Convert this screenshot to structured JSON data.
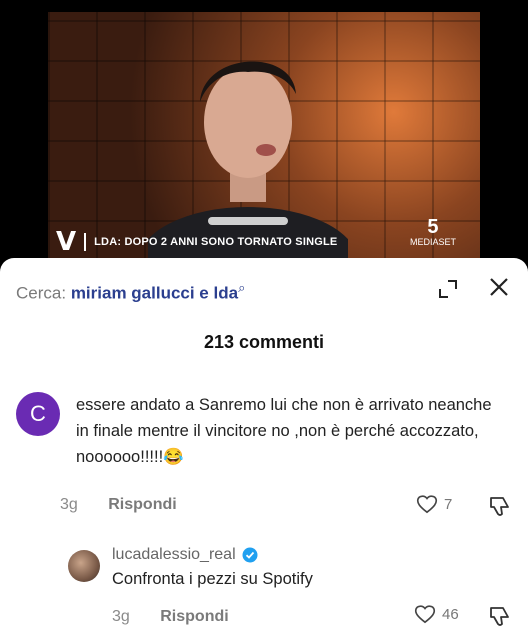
{
  "video": {
    "caption_logo": "V",
    "caption_text": "LDA: DOPO 2 ANNI SONO TORNATO SINGLE",
    "channel_number": "5",
    "channel_name": "MEDIASET"
  },
  "search": {
    "label": "Cerca:",
    "query": "miriam gallucci e lda"
  },
  "comments_count": "213 commenti",
  "comment": {
    "avatar_letter": "C",
    "text": "essere andato a Sanremo lui che non è arrivato neanche in finale mentre il vincitore no ,non è perché accozzato, noooooo!!!!!😂",
    "time": "3g",
    "reply_label": "Rispondi",
    "likes": "7"
  },
  "reply": {
    "username": "lucadalessio_real",
    "text": "Confronta i pezzi su Spotify",
    "time": "3g",
    "reply_label": "Rispondi",
    "likes": "46"
  },
  "colors": {
    "avatar": "#6a2bb3",
    "search_query": "#2b3f8f",
    "verified": "#20a0f0"
  }
}
